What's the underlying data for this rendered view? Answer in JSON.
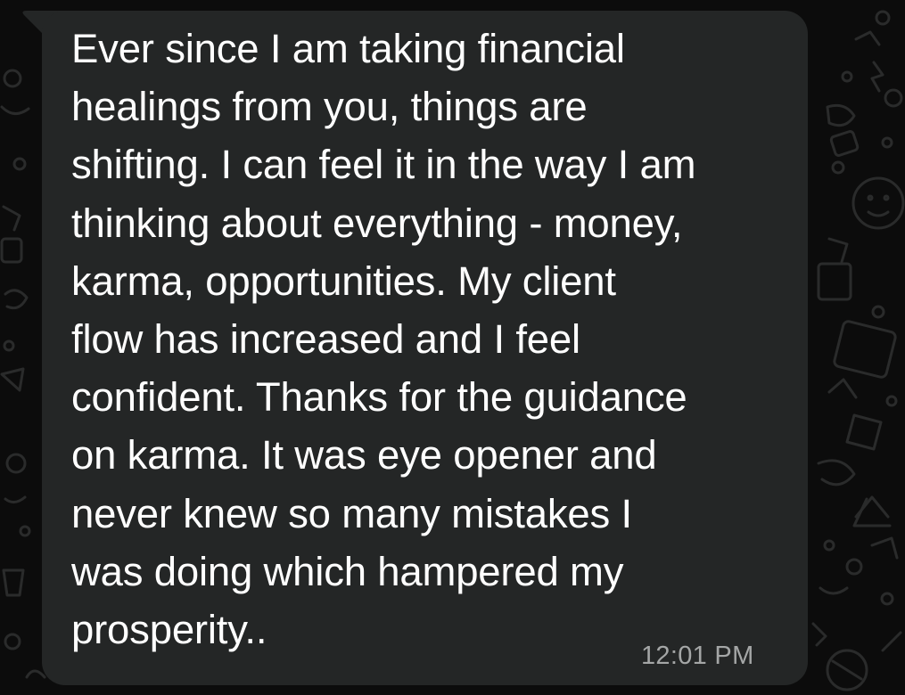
{
  "message": {
    "text": "Ever since I am taking financial\nhealings from you, things are\nshifting. I can feel it in the way I am\nthinking about everything - money,\nkarma, opportunities. My client\nflow has increased and I feel\nconfident. Thanks for the guidance\non karma. It was eye opener and\nnever knew so many mistakes I\nwas doing which hampered my\nprosperity..",
    "time": "12:01 PM",
    "direction": "incoming"
  },
  "colors": {
    "background": "#0c0c0c",
    "bubble": "#242626",
    "text": "#ffffff",
    "timestamp": "#a4a6a6",
    "doodle": "#2a2b2b"
  },
  "icons": [
    "chat-wallpaper-doodles"
  ]
}
